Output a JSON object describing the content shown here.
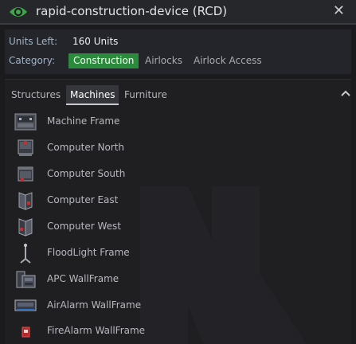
{
  "window": {
    "title": "rapid-construction-device (RCD)",
    "icon": "eye-icon",
    "close_label": "✕"
  },
  "info": {
    "units_label": "Units Left:",
    "units_value": "160 Units",
    "category_label": "Category:",
    "categories": [
      "Construction",
      "Airlocks",
      "Airlock Access"
    ],
    "active_category": "Construction"
  },
  "tabs": [
    "Structures",
    "Machines",
    "Furniture"
  ],
  "active_tab": "Machines",
  "items": [
    {
      "label": "Machine Frame",
      "icon": "machine-frame-icon"
    },
    {
      "label": "Computer North",
      "icon": "computer-north-icon"
    },
    {
      "label": "Computer South",
      "icon": "computer-south-icon"
    },
    {
      "label": "Computer East",
      "icon": "computer-east-icon"
    },
    {
      "label": "Computer West",
      "icon": "computer-west-icon"
    },
    {
      "label": "FloodLight Frame",
      "icon": "floodlight-icon"
    },
    {
      "label": "APC WallFrame",
      "icon": "apc-icon"
    },
    {
      "label": "AirAlarm WallFrame",
      "icon": "air-alarm-icon"
    },
    {
      "label": "FireAlarm WallFrame",
      "icon": "fire-alarm-icon"
    }
  ],
  "colors": {
    "accent_green": "#2b8a3b",
    "eye_green": "#3fa64a",
    "background": "#1b1b1e"
  }
}
